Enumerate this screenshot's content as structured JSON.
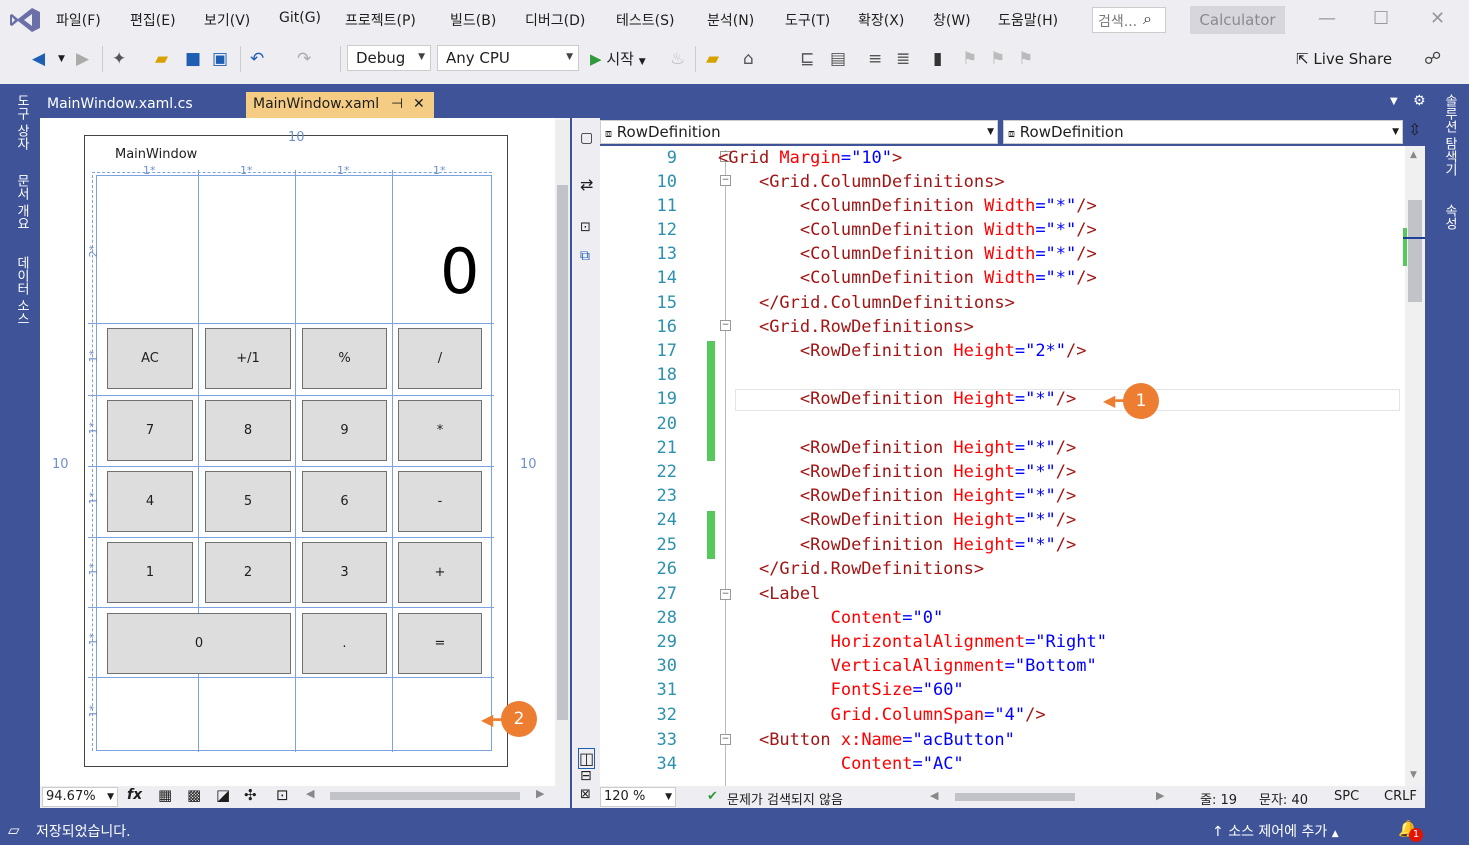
{
  "menu": {
    "items": [
      "파일(F)",
      "편집(E)",
      "보기(V)",
      "Git(G)",
      "프로젝트(P)",
      "빌드(B)",
      "디버그(D)",
      "테스트(S)",
      "분석(N)",
      "도구(T)",
      "확장(X)",
      "창(W)",
      "도움말(H)"
    ],
    "search_placeholder": "검색...",
    "app_title": "Calculator"
  },
  "toolbar": {
    "config": "Debug",
    "platform": "Any CPU",
    "start_label": "시작",
    "live_share": "Live Share"
  },
  "side_left": [
    "도구 상자",
    "문서 개요",
    "데이터 소스"
  ],
  "side_right": [
    "솔루션 탐색기",
    "속성"
  ],
  "tabs": [
    {
      "label": "MainWindow.xaml.cs",
      "active": false
    },
    {
      "label": "MainWindow.xaml",
      "active": true,
      "pin": "⊣",
      "close": "✕"
    }
  ],
  "designer": {
    "window_title": "MainWindow",
    "display": "0",
    "margin_label": "10",
    "col_markers": [
      "1*",
      "1*",
      "1*",
      "1*"
    ],
    "row_markers": [
      "2*",
      "1*",
      "1*",
      "1*",
      "1*",
      "1*",
      "1*"
    ],
    "buttons": [
      {
        "label": "AC"
      },
      {
        "label": "+/1"
      },
      {
        "label": "%"
      },
      {
        "label": "/"
      },
      {
        "label": "7"
      },
      {
        "label": "8"
      },
      {
        "label": "9"
      },
      {
        "label": "*"
      },
      {
        "label": "4"
      },
      {
        "label": "5"
      },
      {
        "label": "6"
      },
      {
        "label": "-"
      },
      {
        "label": "1"
      },
      {
        "label": "2"
      },
      {
        "label": "3"
      },
      {
        "label": "+"
      },
      {
        "label": "0"
      },
      {
        "label": "."
      },
      {
        "label": "="
      }
    ],
    "zoom": "94.67%",
    "fx": "fx"
  },
  "editor": {
    "nav_left": "RowDefinition",
    "nav_right": "RowDefinition",
    "zoom": "120 %",
    "issues": "문제가 검색되지 않음",
    "line": "줄: 19",
    "char": "문자: 40",
    "spc": "SPC",
    "crlf": "CRLF",
    "line_numbers": [
      "9",
      "10",
      "11",
      "12",
      "13",
      "14",
      "15",
      "16",
      "17",
      "18",
      "19",
      "20",
      "21",
      "22",
      "23",
      "24",
      "25",
      "26",
      "27",
      "28",
      "29",
      "30",
      "31",
      "32",
      "33",
      "34"
    ],
    "changed_lines": [
      "17",
      "18",
      "19",
      "20",
      "21",
      "24",
      "25"
    ]
  },
  "callouts": [
    "1",
    "2"
  ],
  "status": {
    "text": "저장되었습니다.",
    "source_control": "소스 제어에 추가",
    "notifications": "1"
  },
  "colors": {
    "accent": "#3f5498",
    "tab_active": "#f5cc84",
    "callout": "#ed7d31",
    "change_bar": "#57c95c"
  }
}
